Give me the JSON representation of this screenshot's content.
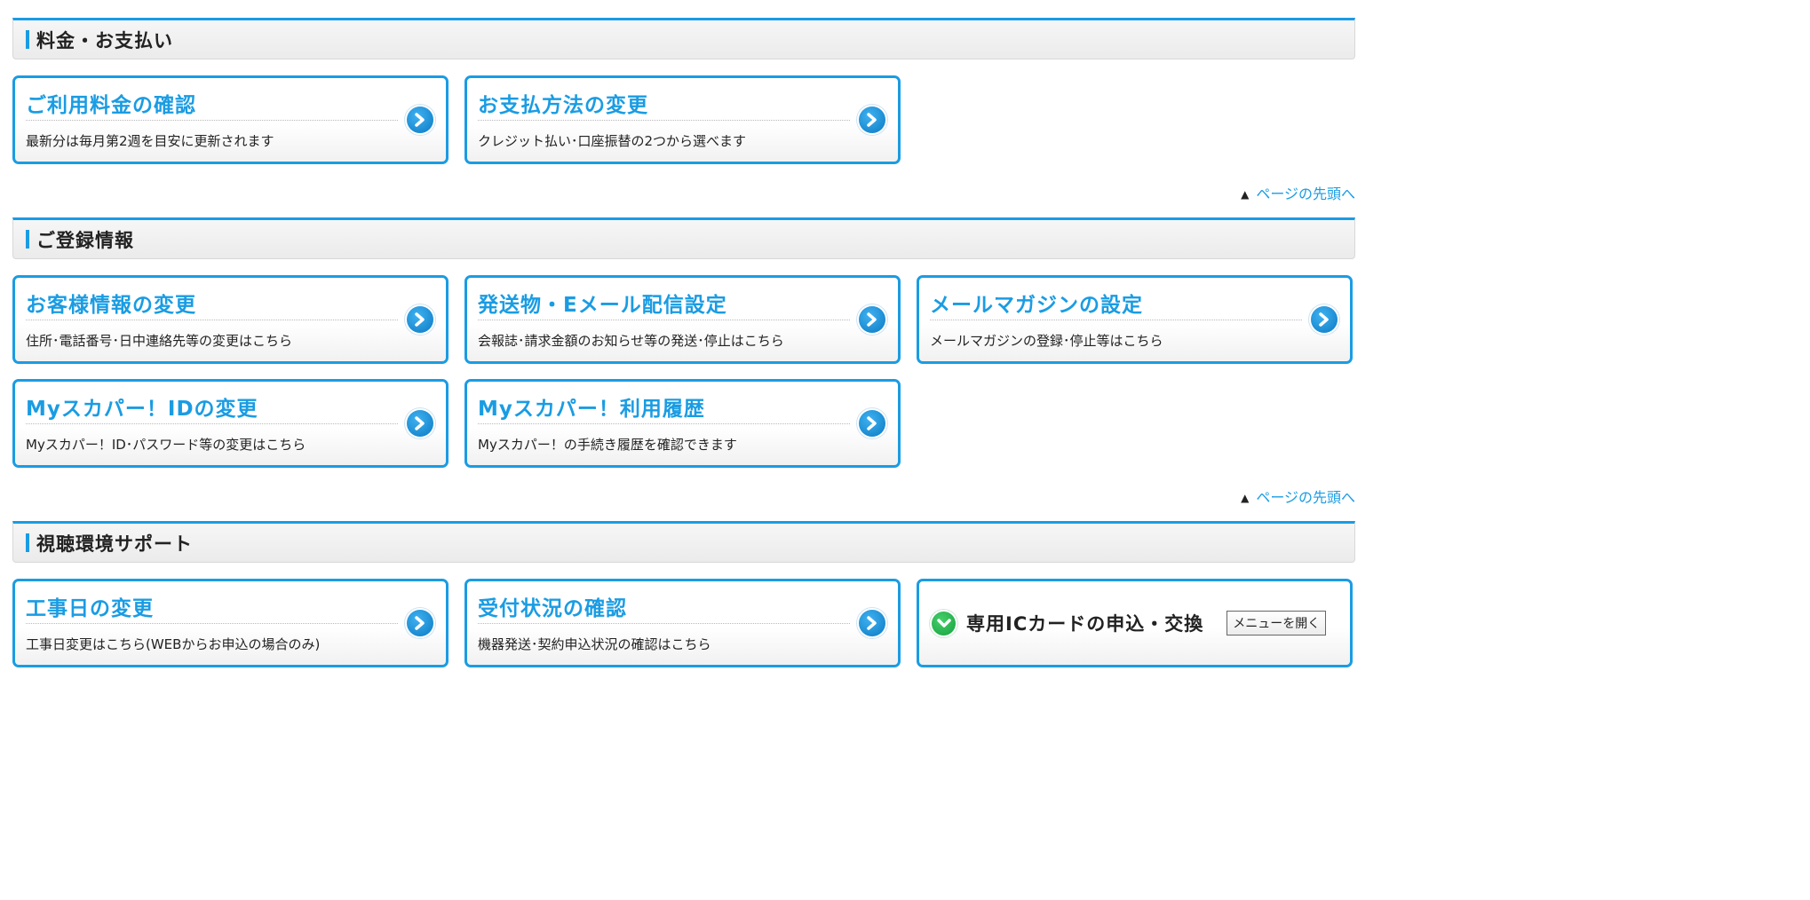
{
  "sections": [
    {
      "title": "料金・お支払い",
      "cards": [
        {
          "title": "ご利用料金の確認",
          "desc": "最新分は毎月第2週を目安に更新されます"
        },
        {
          "title": "お支払方法の変更",
          "desc": "クレジット払い･口座振替の2つから選べます"
        }
      ]
    },
    {
      "title": "ご登録情報",
      "cards": [
        {
          "title": "お客様情報の変更",
          "desc": "住所･電話番号･日中連絡先等の変更はこちら"
        },
        {
          "title": "発送物・Eメール配信設定",
          "desc": "会報誌･請求金額のお知らせ等の発送･停止はこちら"
        },
        {
          "title": "メールマガジンの設定",
          "desc": "メールマガジンの登録･停止等はこちら"
        },
        {
          "title": "Myスカパー！IDの変更",
          "desc": "Myスカパー！ID･パスワード等の変更はこちら"
        },
        {
          "title": "Myスカパー！利用履歴",
          "desc": "Myスカパー！の手続き履歴を確認できます"
        }
      ]
    },
    {
      "title": "視聴環境サポート",
      "cards": [
        {
          "title": "工事日の変更",
          "desc": "工事日変更はこちら(WEBからお申込の場合のみ)"
        },
        {
          "title": "受付状況の確認",
          "desc": "機器発送･契約申込状況の確認はこちら"
        }
      ],
      "special_card": {
        "title": "専用ICカードの申込・交換",
        "button_label": "メニューを開く"
      }
    }
  ],
  "page_top": {
    "marker": "▲",
    "label": "ページの先頭へ"
  },
  "icons": {
    "card_arrow": "chevron-right-circle-icon",
    "expand": "chevron-down-circle-icon"
  },
  "colors": {
    "accent": "#1a9ce3",
    "expand_icon": "#22b14c"
  }
}
